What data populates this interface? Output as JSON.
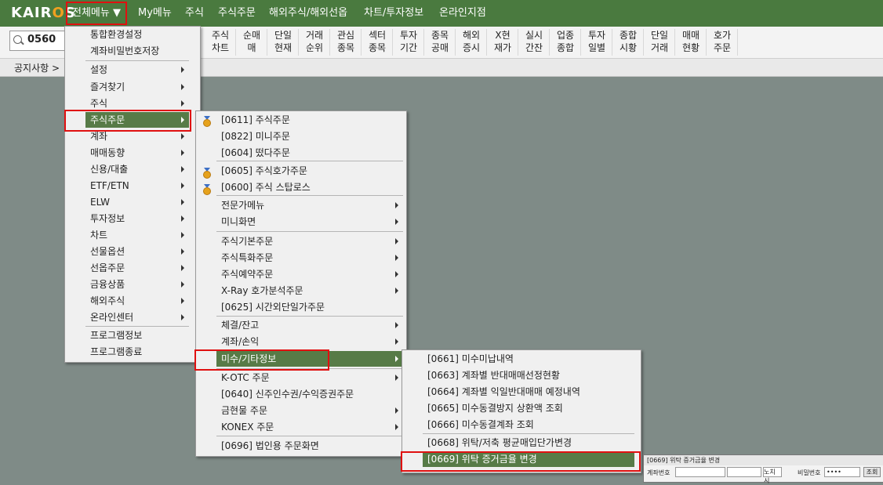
{
  "app": {
    "logo": "KAIROS"
  },
  "topmenu": [
    "전체메뉴 ▼",
    "My메뉴",
    "주식",
    "주식주문",
    "해외주식/해외선옵",
    "차트/투자정보",
    "온라인지점"
  ],
  "toolbar": {
    "search_value": "0560",
    "buttons": [
      [
        "주식",
        "차트"
      ],
      [
        "순매",
        "매"
      ],
      [
        "단일",
        "현재"
      ],
      [
        "거래",
        "순위"
      ],
      [
        "관심",
        "종목"
      ],
      [
        "섹터",
        "종목"
      ],
      [
        "투자",
        "기간"
      ],
      [
        "종목",
        "공매"
      ],
      [
        "해외",
        "증시"
      ],
      [
        "X현",
        "재가"
      ],
      [
        "실시",
        "간잔"
      ],
      [
        "업종",
        "종합"
      ],
      [
        "투자",
        "일별"
      ],
      [
        "종합",
        "시황"
      ],
      [
        "단일",
        "거래"
      ],
      [
        "매매",
        "현황"
      ],
      [
        "호가",
        "주문"
      ]
    ]
  },
  "notice": "공지사항 >",
  "menu1": [
    "통합환경설정",
    "계좌비밀번호저장",
    "설정",
    "즐겨찾기",
    "주식",
    "주식주문",
    "계좌",
    "매매동향",
    "신용/대출",
    "ETF/ETN",
    "ELW",
    "투자정보",
    "차트",
    "선물옵션",
    "선옵주문",
    "금융상품",
    "해외주식",
    "온라인센터",
    "프로그램정보",
    "프로그램종료"
  ],
  "menu2": [
    "[0611] 주식주문",
    "[0822] 미니주문",
    "[0604] 떴다주문",
    "[0605] 주식호가주문",
    "[0600] 주식 스탑로스",
    "전문가메뉴",
    "미니화면",
    "주식기본주문",
    "주식특화주문",
    "주식예약주문",
    "X-Ray 호가분석주문",
    "[0625] 시간외단일가주문",
    "체결/잔고",
    "계좌/손익",
    "미수/기타정보",
    "K-OTC 주문",
    "[0640] 신주인수권/수익증권주문",
    "금현물 주문",
    "KONEX 주문",
    "[0696] 법인용 주문화면"
  ],
  "menu3": [
    "[0661] 미수미납내역",
    "[0663] 계좌별 반대매매선정현황",
    "[0664] 계좌별 익일반대매매 예정내역",
    "[0665] 미수동결방지 상환액 조회",
    "[0666] 미수동결계좌 조회",
    "[0668] 위탁/저축 평균매입단가변경",
    "[0669] 위탁 증거금율 변경"
  ],
  "mini_window": {
    "title": "[0669] 위탁 증거금율 변경",
    "account_label": "계좌번호",
    "name_value": "노치시",
    "password_label": "비밀번호",
    "password_value": "••••",
    "query_button": "조회"
  },
  "colors": {
    "menubar": "#4a7a3f",
    "highlight": "#577b47",
    "desktop": "#7f8b87",
    "redbox": "#e01010"
  }
}
